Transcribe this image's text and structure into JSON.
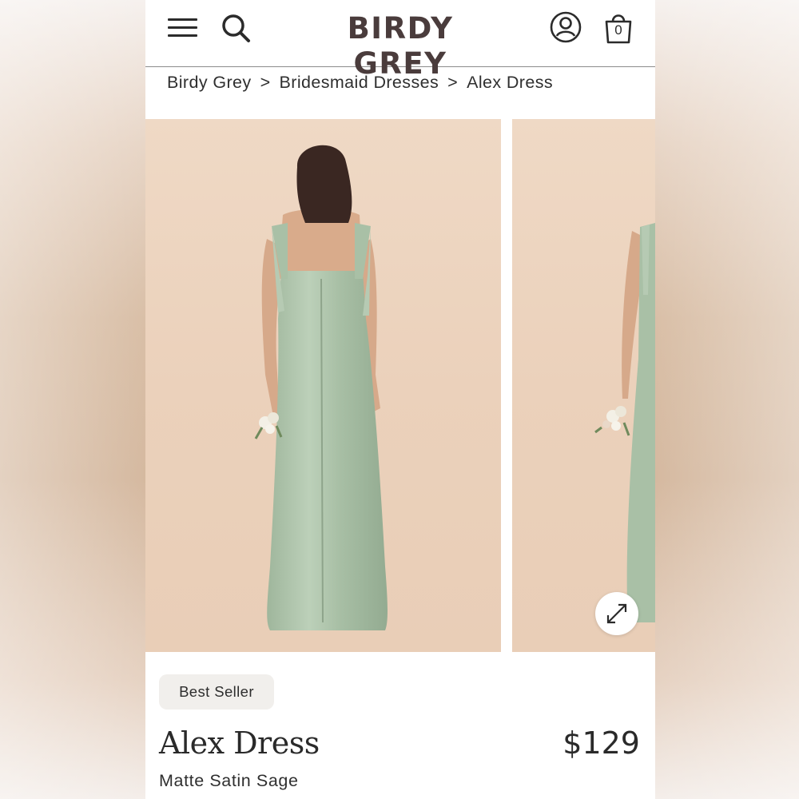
{
  "header": {
    "logo": "BIRDY GREY",
    "bag_count": "0"
  },
  "icons": [
    "menu-icon",
    "search-icon",
    "account-icon",
    "shopping-bag-icon",
    "expand-icon"
  ],
  "breadcrumb": {
    "items": [
      "Birdy Grey",
      "Bridesmaid Dresses",
      "Alex Dress"
    ],
    "separator": ">"
  },
  "product": {
    "badge": "Best Seller",
    "name": "Alex Dress",
    "price": "$129",
    "variant": "Matte Satin Sage"
  },
  "colors": {
    "dress_sage": "#a9c0a6",
    "photo_background": "#ecd3be",
    "logo_text": "#4a3c3c"
  }
}
